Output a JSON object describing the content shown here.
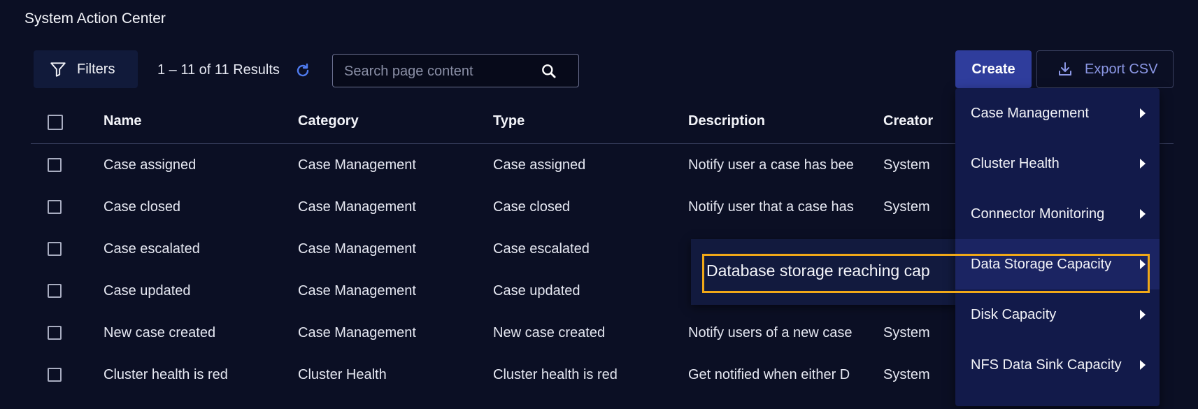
{
  "page": {
    "title": "System Action Center"
  },
  "toolbar": {
    "filters_label": "Filters",
    "results_text": "1 – 11 of 11 Results",
    "search_placeholder": "Search page content",
    "create_label": "Create",
    "export_label": "Export CSV"
  },
  "table": {
    "columns": [
      "Name",
      "Category",
      "Type",
      "Description",
      "Creator"
    ],
    "rows": [
      {
        "name": "Case assigned",
        "category": "Case Management",
        "type": "Case assigned",
        "description": "Notify user a case has bee",
        "creator": "System"
      },
      {
        "name": "Case closed",
        "category": "Case Management",
        "type": "Case closed",
        "description": "Notify user that a case has",
        "creator": "System"
      },
      {
        "name": "Case escalated",
        "category": "Case Management",
        "type": "Case escalated",
        "description": "",
        "creator": ""
      },
      {
        "name": "Case updated",
        "category": "Case Management",
        "type": "Case updated",
        "description": "",
        "creator": ""
      },
      {
        "name": "New case created",
        "category": "Case Management",
        "type": "New case created",
        "description": "Notify users of a new case",
        "creator": "System"
      },
      {
        "name": "Cluster health is red",
        "category": "Cluster Health",
        "type": "Cluster health is red",
        "description": "Get notified when either D",
        "creator": "System"
      }
    ]
  },
  "create_menu": {
    "items": [
      {
        "label": "Case Management"
      },
      {
        "label": "Cluster Health"
      },
      {
        "label": "Connector Monitoring"
      },
      {
        "label": "Data Storage Capacity"
      },
      {
        "label": "Disk Capacity"
      },
      {
        "label": "NFS Data Sink Capacity"
      }
    ],
    "submenu_item": "Database storage reaching cap"
  },
  "colors": {
    "background": "#0b0f24",
    "accent": "#2f3d9c",
    "highlight": "#f0a818"
  },
  "icons": [
    "filter-icon",
    "refresh-icon",
    "search-icon",
    "download-icon",
    "chevron-right-icon"
  ]
}
